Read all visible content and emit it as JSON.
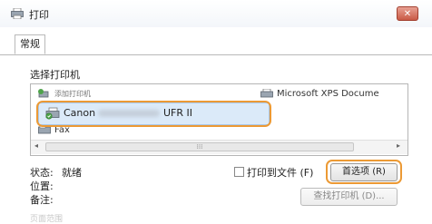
{
  "window": {
    "title": "打印",
    "close_glyph": "✕"
  },
  "tabs": [
    {
      "label": "常规"
    }
  ],
  "printer_section": {
    "label": "选择打印机",
    "printers": [
      {
        "name": "添加打印机",
        "icon": "add-printer-icon"
      },
      {
        "name": "Microsoft XPS Docume",
        "icon": "printer-icon"
      },
      {
        "name": "Canon",
        "model": "UFR II",
        "icon": "canon-printer-icon",
        "selected": true
      },
      {
        "name": "Fax",
        "icon": "fax-icon"
      }
    ],
    "scroll": {
      "left_arrow": "◂",
      "right_arrow": "▸",
      "thumb_grip": "⁞⁞⁞"
    }
  },
  "status": {
    "status_label": "状态:",
    "status_value": "就绪",
    "location_label": "位置:",
    "comment_label": "备注:"
  },
  "print_to_file": {
    "label": "打印到文件 (F)",
    "checked": false
  },
  "buttons": {
    "preferences": "首选项 (R)",
    "find_printer": "查找打印机 (D)..."
  },
  "bottom_hint": "页面范围",
  "colors": {
    "highlight": "#ec9a35",
    "selection": "#dbeaf9",
    "close": "#c95a46"
  }
}
